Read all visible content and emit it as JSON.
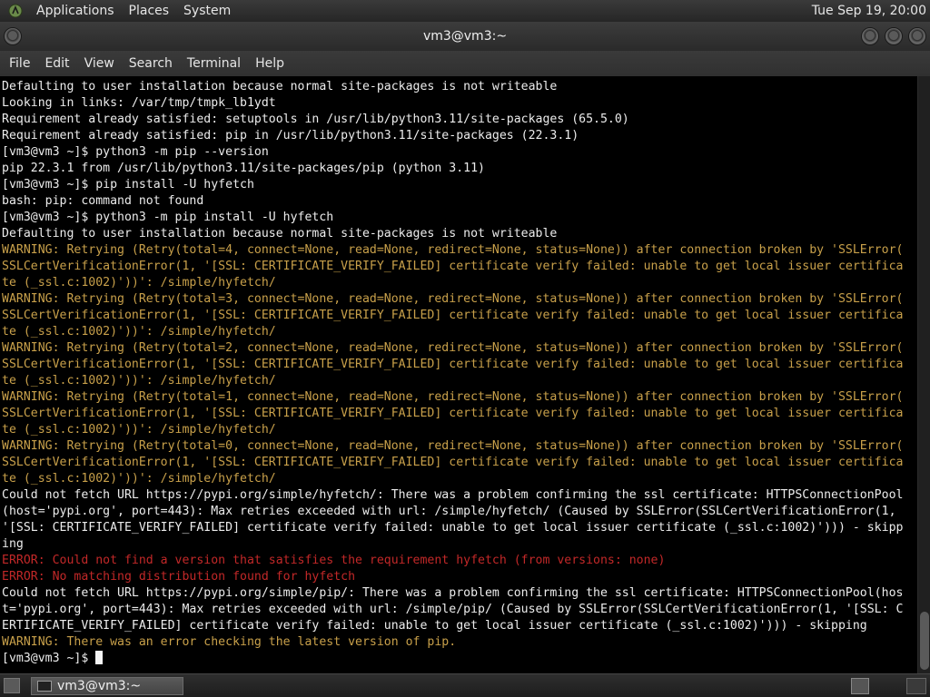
{
  "top_panel": {
    "menus": [
      "Applications",
      "Places",
      "System"
    ],
    "clock": "Tue Sep 19, 20:00"
  },
  "window": {
    "title": "vm3@vm3:~",
    "menus": [
      "File",
      "Edit",
      "View",
      "Search",
      "Terminal",
      "Help"
    ]
  },
  "terminal": {
    "lines": [
      {
        "text": "Defaulting to user installation because normal site-packages is not writeable",
        "style": "normal"
      },
      {
        "text": "Looking in links: /var/tmp/tmpk_lb1ydt",
        "style": "normal"
      },
      {
        "text": "Requirement already satisfied: setuptools in /usr/lib/python3.11/site-packages (65.5.0)",
        "style": "normal"
      },
      {
        "text": "Requirement already satisfied: pip in /usr/lib/python3.11/site-packages (22.3.1)",
        "style": "normal"
      },
      {
        "text": "[vm3@vm3 ~]$ python3 -m pip --version",
        "style": "normal"
      },
      {
        "text": "pip 22.3.1 from /usr/lib/python3.11/site-packages/pip (python 3.11)",
        "style": "normal"
      },
      {
        "text": "[vm3@vm3 ~]$ pip install -U hyfetch",
        "style": "normal"
      },
      {
        "text": "bash: pip: command not found",
        "style": "normal"
      },
      {
        "text": "[vm3@vm3 ~]$ python3 -m pip install -U hyfetch",
        "style": "normal"
      },
      {
        "text": "Defaulting to user installation because normal site-packages is not writeable",
        "style": "normal"
      },
      {
        "text": "WARNING: Retrying (Retry(total=4, connect=None, read=None, redirect=None, status=None)) after connection broken by 'SSLError(",
        "style": "warn"
      },
      {
        "text": "SSLCertVerificationError(1, '[SSL: CERTIFICATE_VERIFY_FAILED] certificate verify failed: unable to get local issuer certifica",
        "style": "warn"
      },
      {
        "text": "te (_ssl.c:1002)'))': /simple/hyfetch/",
        "style": "warn"
      },
      {
        "text": "WARNING: Retrying (Retry(total=3, connect=None, read=None, redirect=None, status=None)) after connection broken by 'SSLError(",
        "style": "warn"
      },
      {
        "text": "SSLCertVerificationError(1, '[SSL: CERTIFICATE_VERIFY_FAILED] certificate verify failed: unable to get local issuer certifica",
        "style": "warn"
      },
      {
        "text": "te (_ssl.c:1002)'))': /simple/hyfetch/",
        "style": "warn"
      },
      {
        "text": "WARNING: Retrying (Retry(total=2, connect=None, read=None, redirect=None, status=None)) after connection broken by 'SSLError(",
        "style": "warn"
      },
      {
        "text": "SSLCertVerificationError(1, '[SSL: CERTIFICATE_VERIFY_FAILED] certificate verify failed: unable to get local issuer certifica",
        "style": "warn"
      },
      {
        "text": "te (_ssl.c:1002)'))': /simple/hyfetch/",
        "style": "warn"
      },
      {
        "text": "WARNING: Retrying (Retry(total=1, connect=None, read=None, redirect=None, status=None)) after connection broken by 'SSLError(",
        "style": "warn"
      },
      {
        "text": "SSLCertVerificationError(1, '[SSL: CERTIFICATE_VERIFY_FAILED] certificate verify failed: unable to get local issuer certifica",
        "style": "warn"
      },
      {
        "text": "te (_ssl.c:1002)'))': /simple/hyfetch/",
        "style": "warn"
      },
      {
        "text": "WARNING: Retrying (Retry(total=0, connect=None, read=None, redirect=None, status=None)) after connection broken by 'SSLError(",
        "style": "warn"
      },
      {
        "text": "SSLCertVerificationError(1, '[SSL: CERTIFICATE_VERIFY_FAILED] certificate verify failed: unable to get local issuer certifica",
        "style": "warn"
      },
      {
        "text": "te (_ssl.c:1002)'))': /simple/hyfetch/",
        "style": "warn"
      },
      {
        "text": "Could not fetch URL https://pypi.org/simple/hyfetch/: There was a problem confirming the ssl certificate: HTTPSConnectionPool",
        "style": "normal"
      },
      {
        "text": "(host='pypi.org', port=443): Max retries exceeded with url: /simple/hyfetch/ (Caused by SSLError(SSLCertVerificationError(1,",
        "style": "normal"
      },
      {
        "text": "'[SSL: CERTIFICATE_VERIFY_FAILED] certificate verify failed: unable to get local issuer certificate (_ssl.c:1002)'))) - skipp",
        "style": "normal"
      },
      {
        "text": "ing",
        "style": "normal"
      },
      {
        "text": "ERROR: Could not find a version that satisfies the requirement hyfetch (from versions: none)",
        "style": "err"
      },
      {
        "text": "ERROR: No matching distribution found for hyfetch",
        "style": "err"
      },
      {
        "text": "Could not fetch URL https://pypi.org/simple/pip/: There was a problem confirming the ssl certificate: HTTPSConnectionPool(hos",
        "style": "normal"
      },
      {
        "text": "t='pypi.org', port=443): Max retries exceeded with url: /simple/pip/ (Caused by SSLError(SSLCertVerificationError(1, '[SSL: C",
        "style": "normal"
      },
      {
        "text": "ERTIFICATE_VERIFY_FAILED] certificate verify failed: unable to get local issuer certificate (_ssl.c:1002)'))) - skipping",
        "style": "normal"
      },
      {
        "text": "WARNING: There was an error checking the latest version of pip.",
        "style": "warn"
      }
    ],
    "prompt": "[vm3@vm3 ~]$ "
  },
  "taskbar": {
    "task_label": "vm3@vm3:~"
  },
  "colors": {
    "warning": "#c8a04a",
    "error": "#c22828",
    "text": "#ececec",
    "background": "#000000"
  },
  "icons": [
    "gnome-foot-icon",
    "close-icon",
    "minimize-icon",
    "maximize-icon",
    "show-desktop-icon",
    "terminal-icon",
    "workspace-switcher-icon",
    "trash-icon"
  ]
}
